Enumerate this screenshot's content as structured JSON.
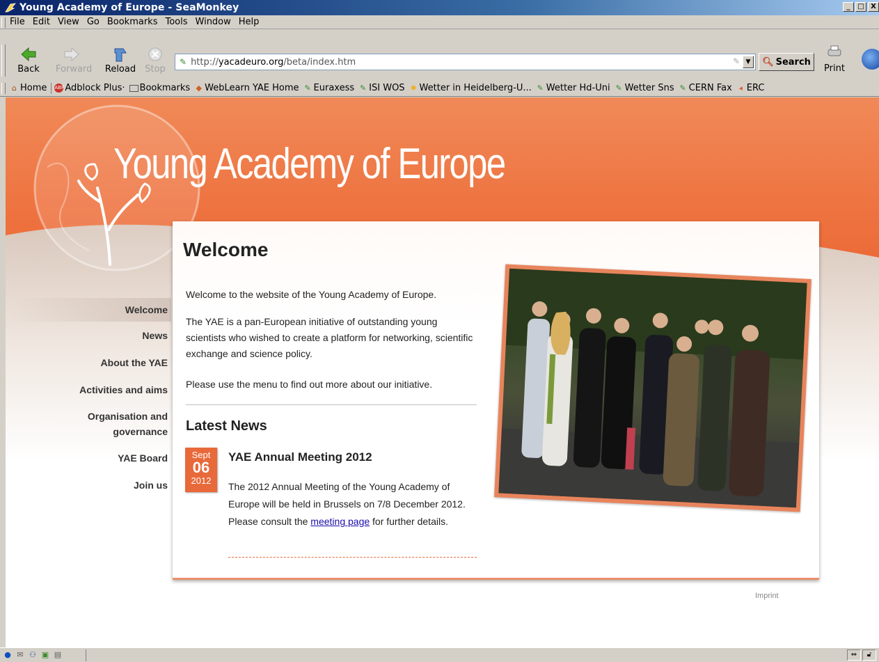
{
  "window": {
    "title": "Young Academy of Europe - SeaMonkey",
    "buttons": [
      "_",
      "□",
      "X"
    ]
  },
  "menubar": [
    "File",
    "Edit",
    "View",
    "Go",
    "Bookmarks",
    "Tools",
    "Window",
    "Help"
  ],
  "navbar": {
    "back": "Back",
    "forward": "Forward",
    "reload": "Reload",
    "stop": "Stop",
    "url_prefix": "http://",
    "url_domain": "yacadeuro.org",
    "url_path": "/beta/index.htm",
    "search": "Search",
    "print": "Print"
  },
  "bookmarks": [
    {
      "label": "Home",
      "icon": "home-icon"
    },
    {
      "label": "Adblock Plus·",
      "icon": "abp-icon"
    },
    {
      "label": "Bookmarks",
      "icon": "folder-icon"
    },
    {
      "label": "WebLearn YAE Home",
      "icon": "weblearn-icon"
    },
    {
      "label": "Euraxess",
      "icon": "bookmark-icon"
    },
    {
      "label": "ISI WOS",
      "icon": "bookmark-icon"
    },
    {
      "label": "Wetter in Heidelberg-U...",
      "icon": "sun-icon"
    },
    {
      "label": "Wetter Hd-Uni",
      "icon": "bookmark-icon"
    },
    {
      "label": "Wetter Sns",
      "icon": "bookmark-icon"
    },
    {
      "label": "CERN Fax",
      "icon": "bookmark-icon"
    },
    {
      "label": "ERC",
      "icon": "erc-icon"
    }
  ],
  "site": {
    "title": "Young Academy of Europe",
    "menu": [
      "Welcome",
      "News",
      "About the YAE",
      "Activities and aims",
      "Organisation and governance",
      "YAE Board",
      "Join us"
    ],
    "heading": "Welcome",
    "intro": [
      "Welcome to the website of the Young Academy of Europe.",
      "The YAE is a pan-European initiative of outstanding young scientists who wished to create a platform for networking, scientific exchange and science policy.",
      "Please use the menu to find out more about our initiative."
    ],
    "latest_news_heading": "Latest News",
    "news": {
      "month": "Sept",
      "day": "06",
      "year": "2012",
      "title": "YAE Annual Meeting 2012",
      "body_before": "The 2012 Annual Meeting of the Young Academy of Europe will be held in Brussels on 7/8 December 2012. Please consult the ",
      "link": "meeting page",
      "body_after": " for further details."
    },
    "imprint": "Imprint"
  }
}
